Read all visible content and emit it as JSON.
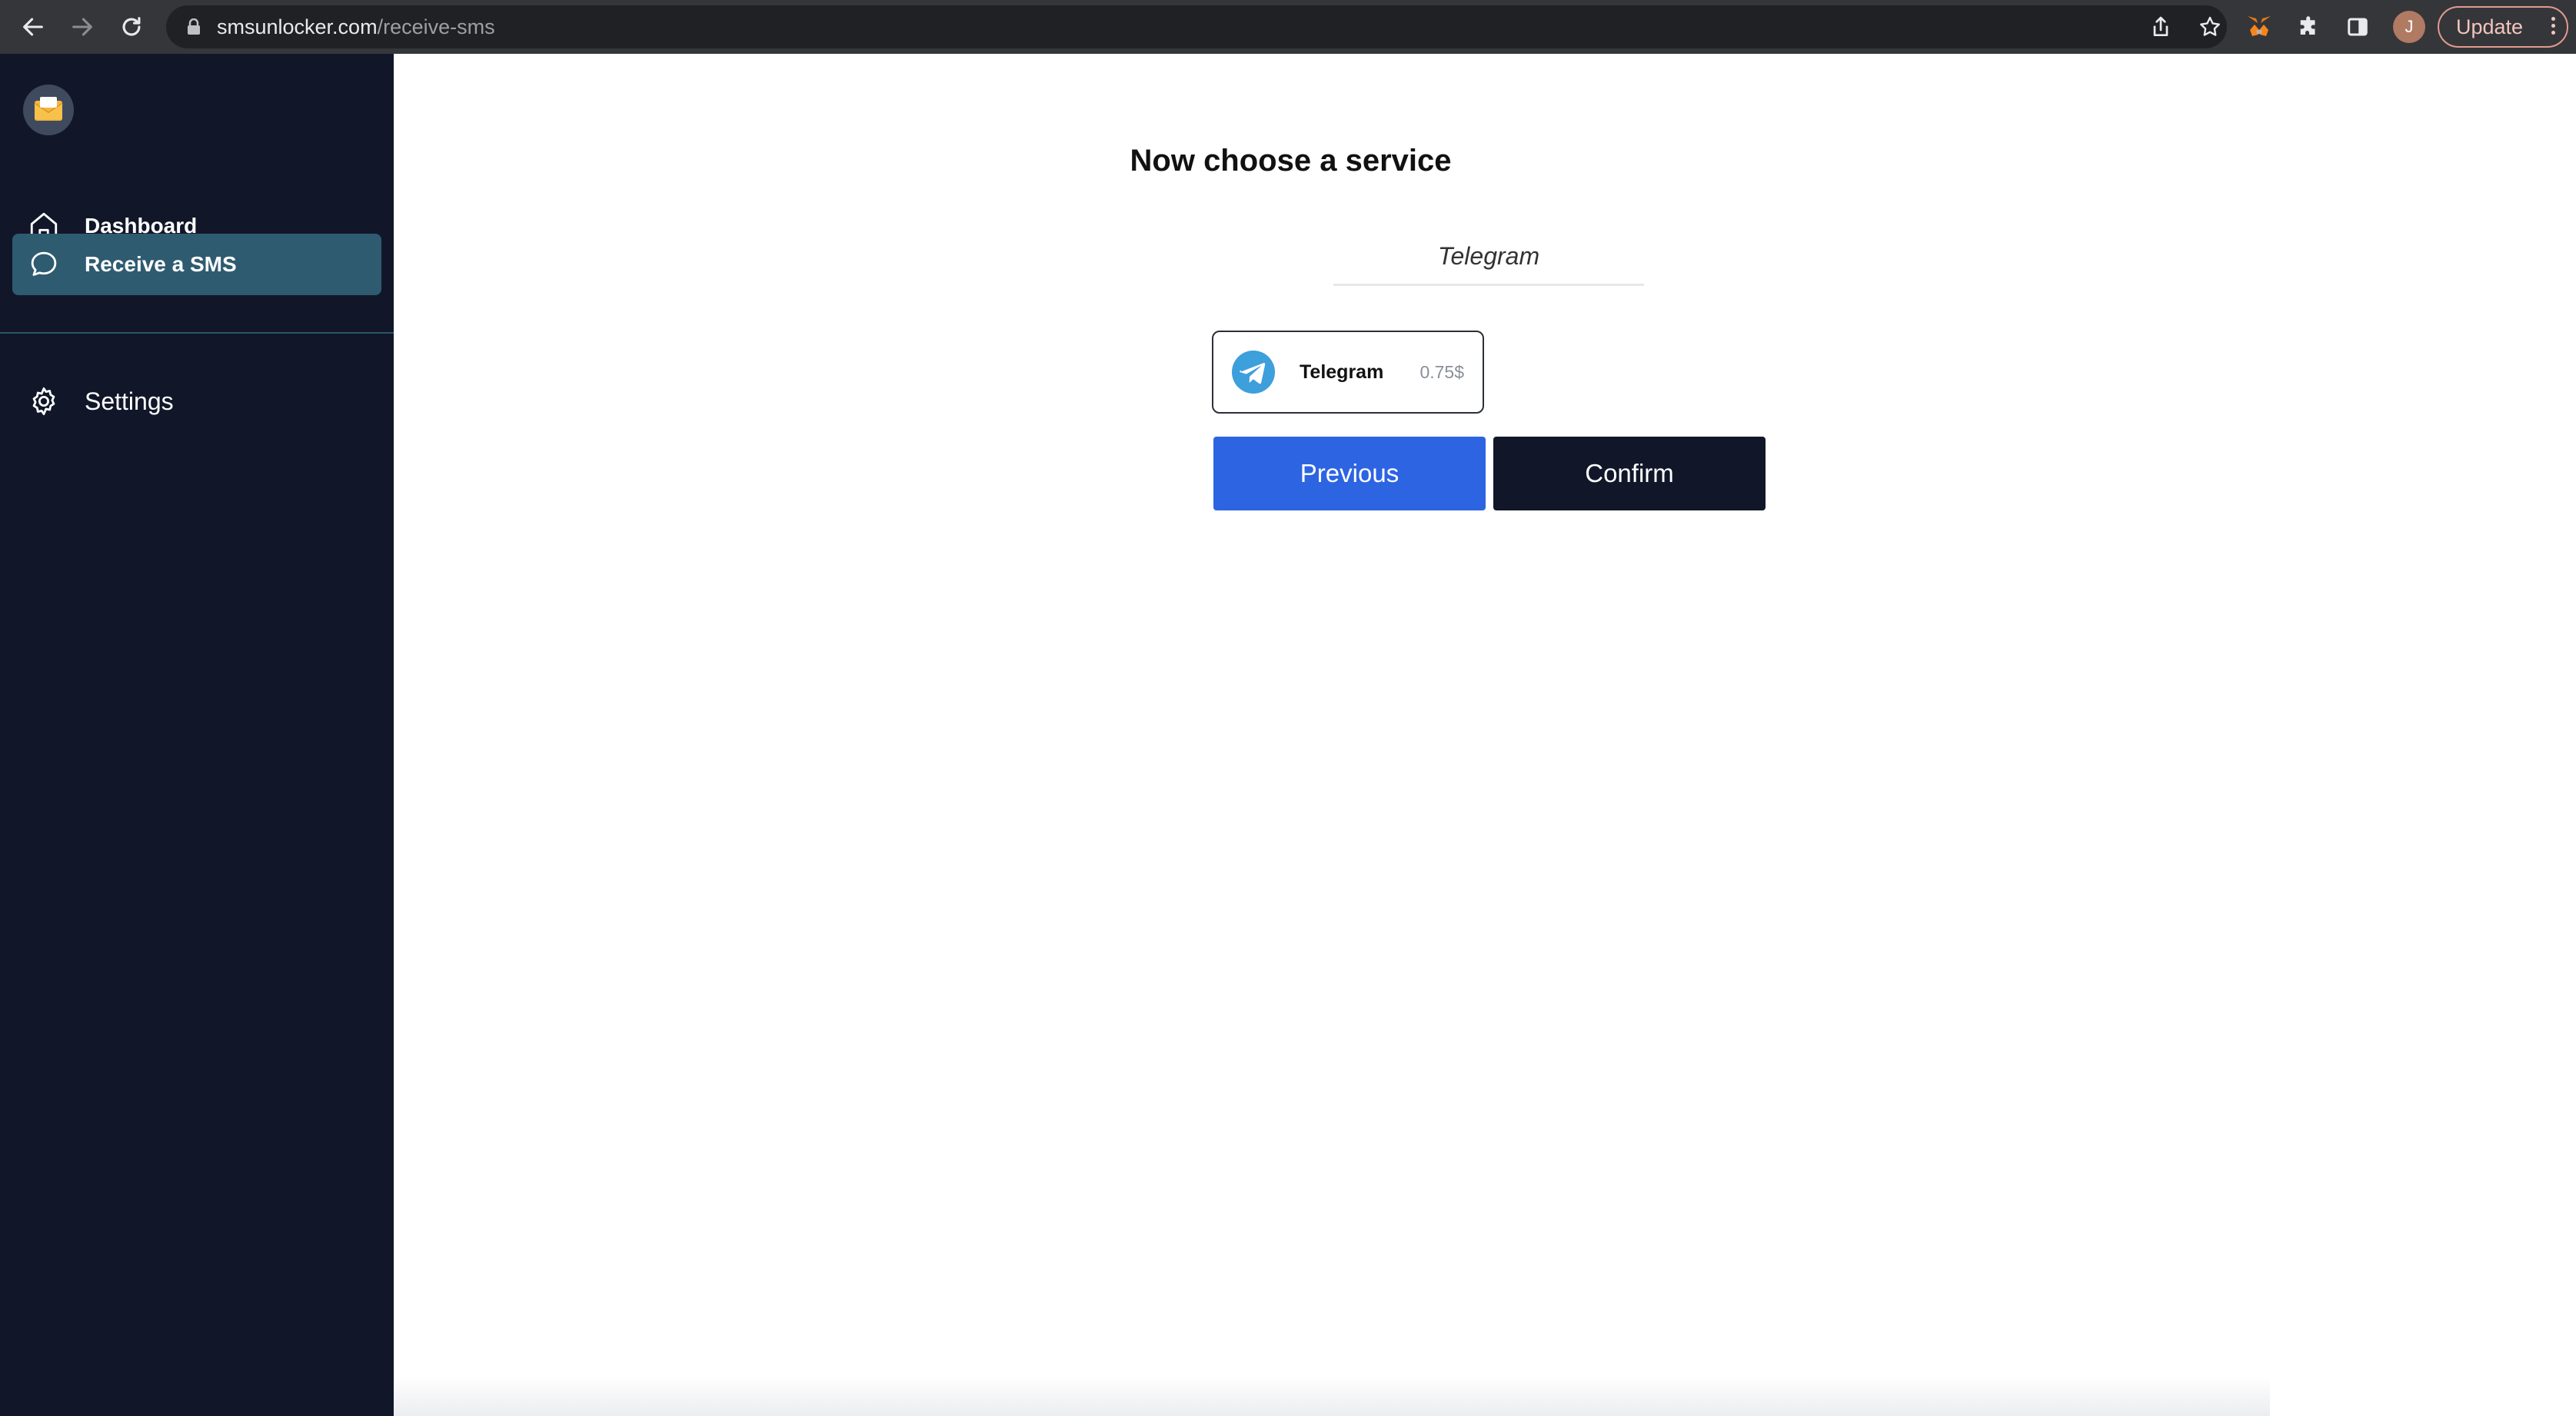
{
  "browser": {
    "url_host": "smsunlocker.com",
    "url_path": "/receive-sms",
    "avatar_letter": "J",
    "update_label": "Update",
    "icons": [
      "back-arrow-icon",
      "forward-arrow-icon",
      "reload-icon",
      "lock-icon",
      "share-icon",
      "star-icon",
      "metamask-fox-icon",
      "puzzle-extension-icon",
      "side-panel-icon",
      "kebab-menu-icon"
    ]
  },
  "sidebar": {
    "logo_icon": "envelope-icon",
    "items": [
      {
        "label": "Dashboard",
        "icon": "home-icon",
        "active": false
      },
      {
        "label": "Receive a SMS",
        "icon": "chat-bubble-icon",
        "active": true
      },
      {
        "label": "Settings",
        "icon": "gear-icon",
        "active": false
      }
    ]
  },
  "main": {
    "heading": "Now choose a service",
    "search": {
      "value": "Telegram"
    },
    "services": [
      {
        "name": "Telegram",
        "price": "0.75$",
        "icon": "telegram-icon"
      }
    ],
    "buttons": {
      "previous": "Previous",
      "confirm": "Confirm"
    }
  },
  "colors": {
    "sidebar_bg": "#111729",
    "active_item": "#2f5b70",
    "primary_blue": "#2d64e2",
    "dark_button": "#111729",
    "telegram_blue": "#3d9fdc"
  }
}
